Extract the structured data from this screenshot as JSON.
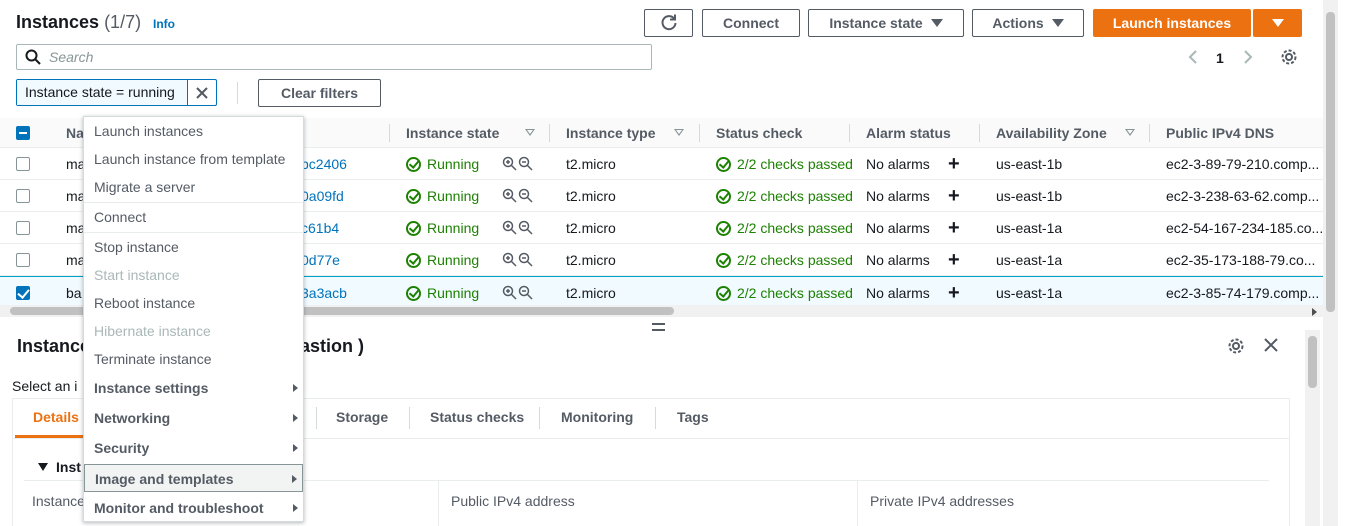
{
  "header": {
    "title": "Instances",
    "count": "(1/7)",
    "info": "Info",
    "buttons": {
      "refresh_icon": "refresh-icon",
      "connect": "Connect",
      "instance_state": "Instance state",
      "actions": "Actions",
      "launch": "Launch instances"
    }
  },
  "search": {
    "placeholder": "Search"
  },
  "pagination": {
    "page": "1"
  },
  "filter": {
    "token": "Instance state = running",
    "clear": "Clear filters"
  },
  "table": {
    "columns": [
      "Na",
      "Instance state",
      "Instance type",
      "Status check",
      "Alarm status",
      "Availability Zone",
      "Public IPv4 DNS"
    ],
    "rows": [
      {
        "name": "ma",
        "id": "bc2406",
        "state": "Running",
        "type": "t2.micro",
        "status": "2/2 checks passed",
        "alarm": "No alarms",
        "az": "us-east-1b",
        "dns": "ec2-3-89-79-210.comp...",
        "selected": false
      },
      {
        "name": "ma",
        "id": "0a09fd",
        "state": "Running",
        "type": "t2.micro",
        "status": "2/2 checks passed",
        "alarm": "No alarms",
        "az": "us-east-1b",
        "dns": "ec2-3-238-63-62.comp...",
        "selected": false
      },
      {
        "name": "ma",
        "id": "c61b4",
        "state": "Running",
        "type": "t2.micro",
        "status": "2/2 checks passed",
        "alarm": "No alarms",
        "az": "us-east-1a",
        "dns": "ec2-54-167-234-185.co...",
        "selected": false
      },
      {
        "name": "ma",
        "id": "0d77e",
        "state": "Running",
        "type": "t2.micro",
        "status": "2/2 checks passed",
        "alarm": "No alarms",
        "az": "us-east-1a",
        "dns": "ec2-35-173-188-79.co...",
        "selected": false
      },
      {
        "name": "ba",
        "id": "3a3acb",
        "state": "Running",
        "type": "t2.micro",
        "status": "2/2 checks passed",
        "alarm": "No alarms",
        "az": "us-east-1a",
        "dns": "ec2-3-85-74-179.comp...",
        "selected": true
      }
    ]
  },
  "menu": {
    "items": [
      {
        "label": "Launch instances",
        "kind": "item"
      },
      {
        "label": "Launch instance from template",
        "kind": "item"
      },
      {
        "label": "Migrate a server",
        "kind": "item"
      },
      {
        "label": "Connect",
        "kind": "item"
      },
      {
        "label": "Stop instance",
        "kind": "item"
      },
      {
        "label": "Start instance",
        "kind": "disabled"
      },
      {
        "label": "Reboot instance",
        "kind": "item"
      },
      {
        "label": "Hibernate instance",
        "kind": "disabled"
      },
      {
        "label": "Terminate instance",
        "kind": "item"
      },
      {
        "label": "Instance settings",
        "kind": "group"
      },
      {
        "label": "Networking",
        "kind": "group"
      },
      {
        "label": "Security",
        "kind": "group"
      },
      {
        "label": "Image and templates",
        "kind": "group-hover"
      },
      {
        "label": "Monitor and troubleshoot",
        "kind": "group"
      }
    ]
  },
  "panel": {
    "title_start": "Instance",
    "title_end": "astion )",
    "subtitle": "Select an i",
    "tabs": [
      "Details",
      "Storage",
      "Status checks",
      "Monitoring",
      "Tags"
    ],
    "section": "Inst",
    "labels": [
      "Instance",
      "Public IPv4 address",
      "Private IPv4 addresses"
    ]
  },
  "colors": {
    "accent": "#ec7211",
    "link": "#0073bb",
    "success": "#1d8102"
  }
}
